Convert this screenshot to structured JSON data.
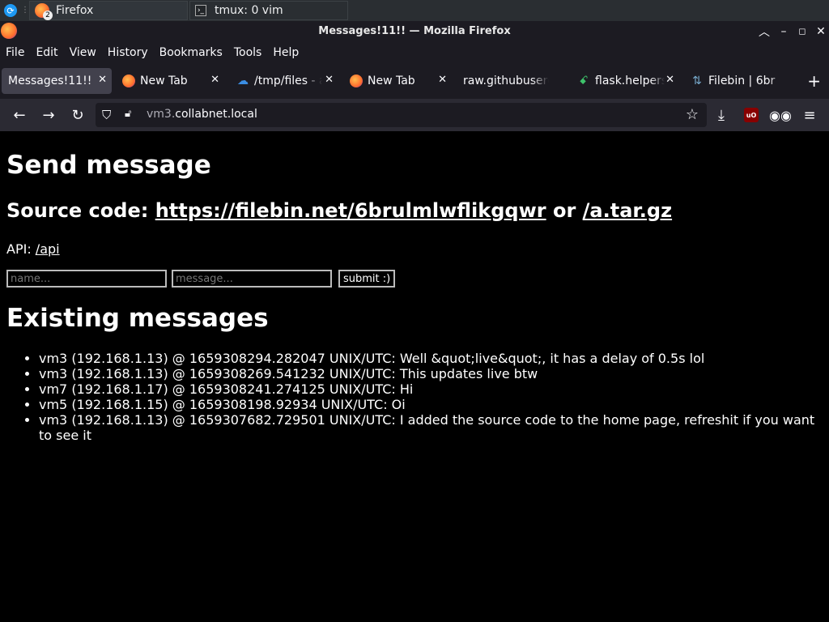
{
  "taskbar": {
    "firefox_task": "Firefox",
    "firefox_badge": "2",
    "tmux_task": "tmux: 0 vim"
  },
  "window": {
    "title": "Messages!11!! — Mozilla Firefox"
  },
  "menu": {
    "items": [
      {
        "label": "File"
      },
      {
        "label": "Edit"
      },
      {
        "label": "View"
      },
      {
        "label": "History"
      },
      {
        "label": "Bookmarks"
      },
      {
        "label": "Tools"
      },
      {
        "label": "Help"
      }
    ]
  },
  "tabs": [
    {
      "label": "Messages!11!!",
      "icon": "none",
      "active": true
    },
    {
      "label": "New Tab",
      "icon": "firefox-icon"
    },
    {
      "label": "/tmp/files - a",
      "icon": "cloud-icon"
    },
    {
      "label": "New Tab",
      "icon": "firefox-icon"
    },
    {
      "label": "raw.githubuserc",
      "icon": "none"
    },
    {
      "label": "flask.helpers",
      "icon": "flask-icon"
    },
    {
      "label": "Filebin | 6br",
      "icon": "filebin-icon"
    }
  ],
  "nav": {
    "url_prefix": "vm3.",
    "url_host": "collabnet.local"
  },
  "page": {
    "heading": "Send message",
    "source_label": "Source code: ",
    "source_link": "https://filebin.net/6brulmlwflikgqwr",
    "source_or": " or ",
    "source_link2": "/a.tar.gz",
    "api_label": "API: ",
    "api_link": "/api",
    "name_placeholder": "name...",
    "message_placeholder": "message...",
    "submit_label": "submit :)",
    "existing_heading": "Existing messages",
    "messages": [
      "vm3 (192.168.1.13) @ 1659308294.282047 UNIX/UTC: Well &quot;live&quot;, it has a delay of 0.5s lol",
      "vm3 (192.168.1.13) @ 1659308269.541232 UNIX/UTC: This updates live btw",
      "vm7 (192.168.1.17) @ 1659308241.274125 UNIX/UTC: Hi",
      "vm5 (192.168.1.15) @ 1659308198.92934 UNIX/UTC: Oi",
      "vm3 (192.168.1.13) @ 1659307682.729501 UNIX/UTC: I added the source code to the home page, refreshit if you want to see it"
    ]
  }
}
